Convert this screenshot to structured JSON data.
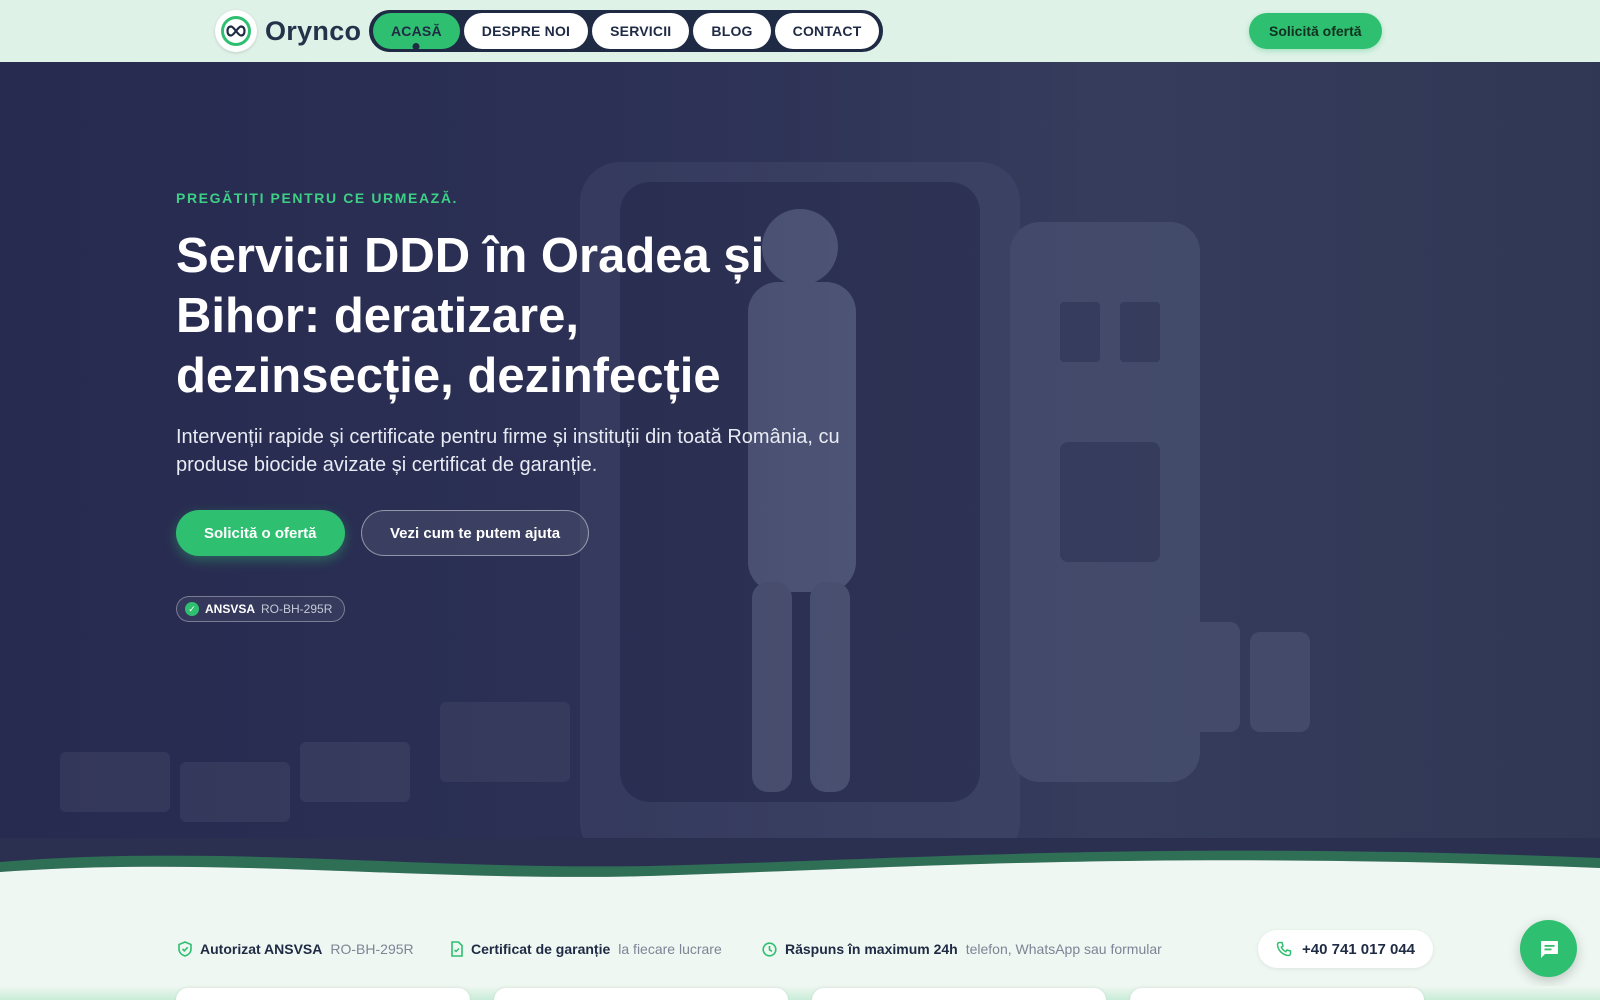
{
  "brand": {
    "name": "Orynco",
    "logo_icon": "infinity-icon"
  },
  "nav": {
    "items": [
      {
        "label": "ACASĂ",
        "active": true
      },
      {
        "label": "DESPRE NOI",
        "active": false
      },
      {
        "label": "SERVICII",
        "active": false
      },
      {
        "label": "BLOG",
        "active": false
      },
      {
        "label": "CONTACT",
        "active": false
      }
    ],
    "cta": "Solicită ofertă"
  },
  "hero": {
    "eyebrow": "PREGĂTIȚI PENTRU CE URMEAZĂ.",
    "title": "Servicii DDD în Oradea și Bihor: deratizare, dezinsecție, dezinfecție",
    "subtitle": "Intervenții rapide și certificate pentru firme și instituții din toată România, cu produse biocide avizate și certificat de garanție.",
    "primary_cta": "Solicită o ofertă",
    "secondary_cta": "Vezi cum te putem ajuta",
    "badge": {
      "authority": "ANSVSA",
      "code": "RO-BH-295R"
    }
  },
  "trust_bar": [
    {
      "icon": "shield-icon",
      "strong": "Autorizat ANSVSA",
      "muted": "RO-BH-295R"
    },
    {
      "icon": "document-icon",
      "strong": "Certificat de garanție",
      "muted": "la fiecare lucrare"
    },
    {
      "icon": "clock-icon",
      "strong": "Răspuns în maximum 24h",
      "muted": "telefon, WhatsApp sau formular"
    }
  ],
  "phone": {
    "icon": "phone-icon",
    "number": "+40 741 017 044"
  },
  "chat": {
    "icon": "chat-bubble-icon"
  },
  "colors": {
    "accent": "#2fbf71",
    "navy": "#1f2a44",
    "hero_bg": "#2f3559",
    "page_bg": "#eef7f1"
  }
}
